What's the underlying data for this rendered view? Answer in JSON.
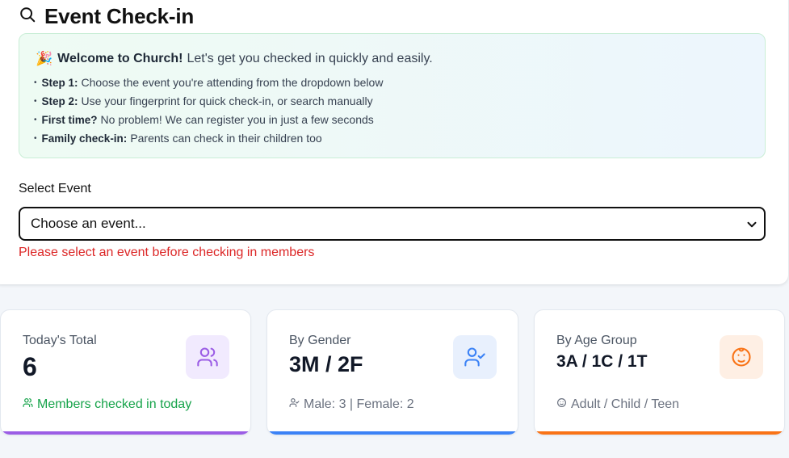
{
  "header": {
    "title": "Event Check-in",
    "icon": "search-icon"
  },
  "welcome": {
    "emoji": "🎉",
    "bold": "Welcome to Church!",
    "text": "Let's get you checked in quickly and easily.",
    "steps": [
      {
        "bold": "Step 1:",
        "text": "Choose the event you're attending from the dropdown below"
      },
      {
        "bold": "Step 2:",
        "text": "Use your fingerprint for quick check-in, or search manually"
      },
      {
        "bold": "First time?",
        "text": "No problem! We can register you in just a few seconds"
      },
      {
        "bold": "Family check-in:",
        "text": "Parents can check in their children too"
      }
    ]
  },
  "event_select": {
    "label": "Select Event",
    "selected": "Choose an event...",
    "error": "Please select an event before checking in members"
  },
  "stats": [
    {
      "label": "Today's Total",
      "value": "6",
      "sub": "Members checked in today",
      "icon": "users-icon",
      "accent": "#9b5de5",
      "sub_color": "#16a34a"
    },
    {
      "label": "By Gender",
      "value": "3M / 2F",
      "sub": "Male: 3 | Female: 2",
      "icon": "user-check-icon",
      "accent": "#3b82f6",
      "sub_color": "#6b7280"
    },
    {
      "label": "By Age Group",
      "value": "3A / 1C / 1T",
      "sub": "Adult / Child / Teen",
      "icon": "baby-icon",
      "accent": "#f97316",
      "sub_color": "#6b7280"
    }
  ]
}
